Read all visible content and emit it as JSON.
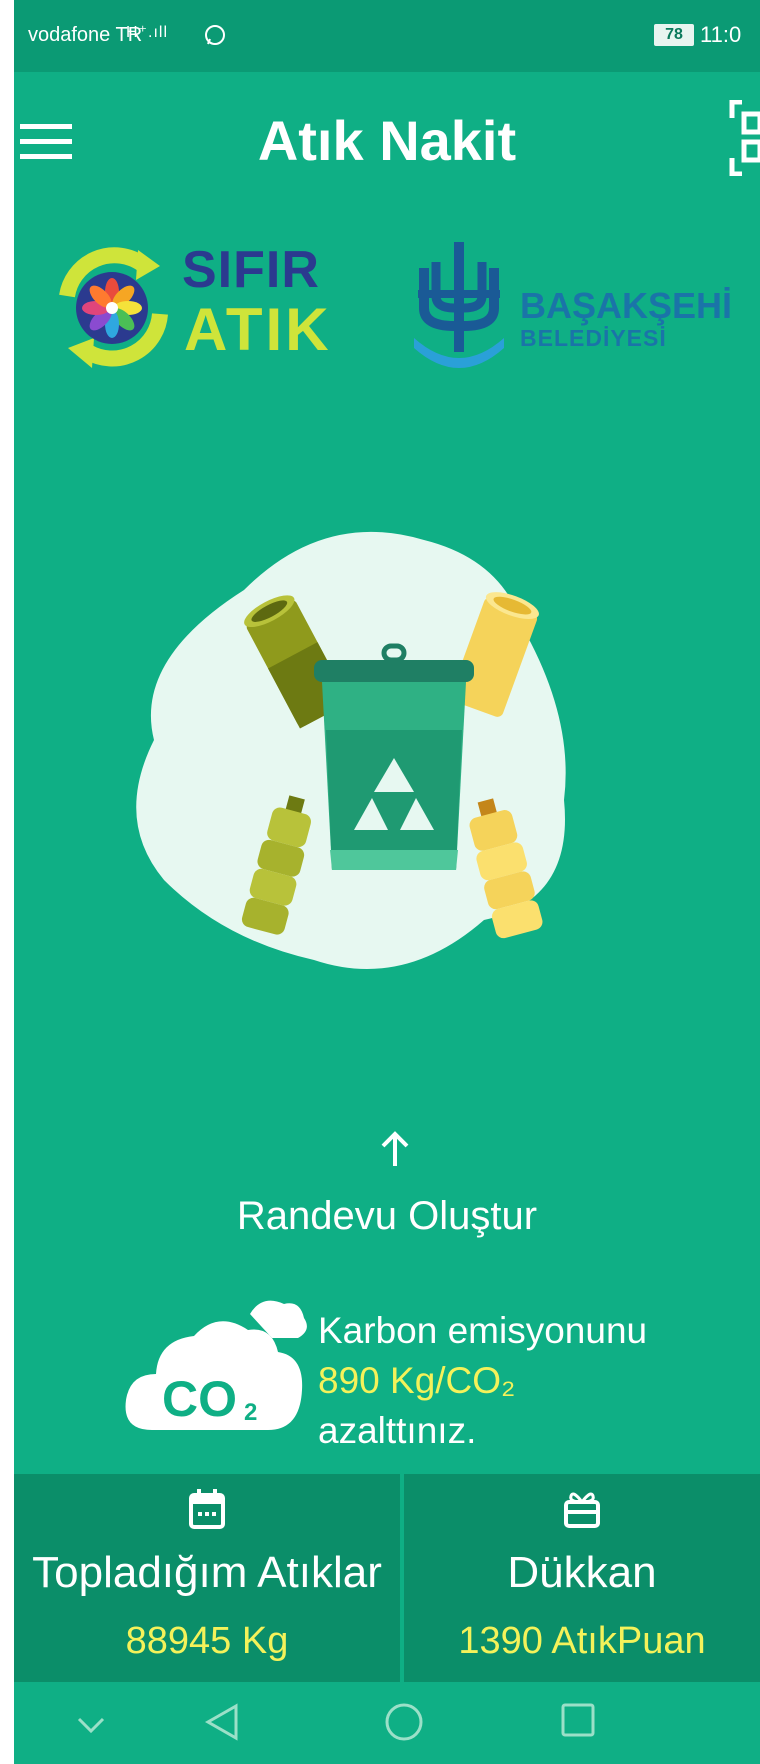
{
  "status_bar": {
    "carrier": "vodafone TR",
    "signal": "H⁺.ıll",
    "battery": "78",
    "time": "11:0"
  },
  "app_bar": {
    "title": "Atık Nakit"
  },
  "logos": {
    "sifir_line1": "SIFIR",
    "sifir_line2": "ATIK",
    "basak_line1": "BAŞAKŞEHİ",
    "basak_line2": "BELEDİYESİ"
  },
  "action": {
    "label": "Randevu Oluştur"
  },
  "carbon": {
    "line1": "Karbon emisyonunu",
    "value": "890 Kg/CO₂",
    "line3": "azalttınız.",
    "icon_text": "CO",
    "icon_sub": "2"
  },
  "cards": [
    {
      "title": "Topladığım Atıklar",
      "value": "88945 Kg",
      "icon": "calendar-icon"
    },
    {
      "title": "Dükkan",
      "value": "1390 AtıkPuan",
      "icon": "gift-icon"
    }
  ],
  "colors": {
    "background": "#0faf85",
    "status_bar": "#0b9a74",
    "card": "#0b8e69",
    "accent_yellow": "#f4f25a"
  }
}
